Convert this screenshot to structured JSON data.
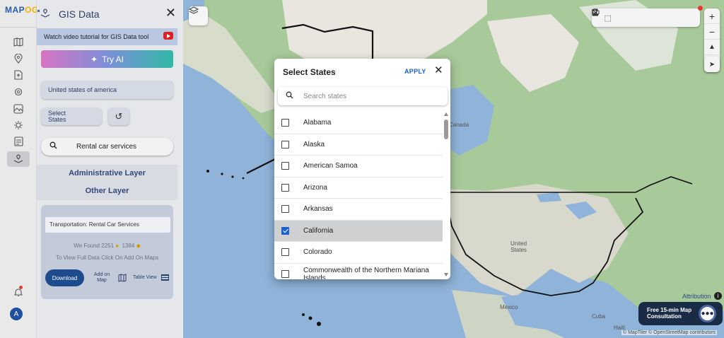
{
  "app": {
    "logo_text_a": "MAP",
    "logo_text_b": "OG"
  },
  "rail": {
    "items": [
      "map-icon",
      "location-pin-icon",
      "upload-icon",
      "settings-icon",
      "gallery-icon",
      "gear-icon",
      "list-icon",
      "gis-data-icon"
    ],
    "bottom": {
      "notification": "bell-icon",
      "avatar_letter": "A"
    }
  },
  "panel": {
    "title": "GIS Data",
    "tutorial_text": "Watch video tutorial for GIS Data tool",
    "try_ai_label": "Try AI",
    "country_value": "United states of america",
    "select_states_line1": "Select",
    "select_states_line2": "States",
    "search_value": "Rental car services",
    "admin_layer_label": "Administrative Layer",
    "other_layer_label": "Other Layer",
    "result": {
      "category": "Transportation: Rental Car Services",
      "found_label": "We Found",
      "found_count_a": "2251",
      "found_count_b": "1384",
      "view_full_text": "To View Full Data Click On Add On Maps",
      "download_label": "Download",
      "add_on_map_line1": "Add on",
      "add_on_map_line2": "Map",
      "table_view_label": "Table View"
    }
  },
  "map": {
    "labels": {
      "canada": "Canada",
      "united_states_line1": "United",
      "united_states_line2": "States",
      "mexico": "Mexico",
      "cuba": "Cuba",
      "haiti": "Haiti"
    },
    "attribution_label": "Attribution",
    "consult_line1": "Free 15-min Map",
    "consult_line2": "Consultation",
    "copyright": "© MapTiler © OpenStreetMap contributors",
    "colors": {
      "water": "#8fb3d9",
      "land": "#d9d5c9",
      "forest": "#a8c99a"
    }
  },
  "modal": {
    "title": "Select States",
    "apply_label": "APPLY",
    "search_placeholder": "Search states",
    "states": [
      {
        "name": "Alabama",
        "checked": false
      },
      {
        "name": "Alaska",
        "checked": false
      },
      {
        "name": "American Samoa",
        "checked": false
      },
      {
        "name": "Arizona",
        "checked": false
      },
      {
        "name": "Arkansas",
        "checked": false
      },
      {
        "name": "California",
        "checked": true
      },
      {
        "name": "Colorado",
        "checked": false
      },
      {
        "name": "Commonwealth of the Northern Mariana Islands",
        "checked": false
      }
    ]
  }
}
